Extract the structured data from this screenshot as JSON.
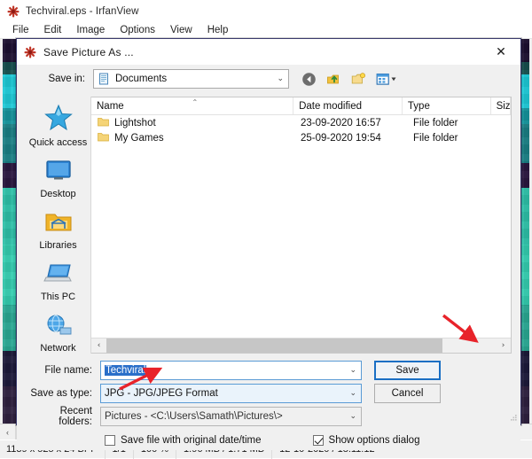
{
  "app": {
    "title": "Techviral.eps - IrfanView",
    "icon": "irfanview-icon",
    "menu": [
      "File",
      "Edit",
      "Image",
      "Options",
      "View",
      "Help"
    ]
  },
  "statusbar": {
    "dimensions": "1139 x 525 x 24 BPP",
    "page": "1/1",
    "zoom": "100 %",
    "size": "1.96 MB / 1.71 MB",
    "datetime": "12-10-2020 / 18:11:12"
  },
  "dialog": {
    "title": "Save Picture As ...",
    "icon": "irfanview-icon",
    "close_label": "✕",
    "savein": {
      "label": "Save in:",
      "value": "Documents",
      "icon": "documents-folder-icon",
      "arrow": "⌄"
    },
    "toolbar": [
      {
        "name": "back-icon",
        "title": "Back"
      },
      {
        "name": "up-one-level-icon",
        "title": "Up one level"
      },
      {
        "name": "new-folder-icon",
        "title": "Create New Folder"
      },
      {
        "name": "views-icon",
        "title": "Views"
      }
    ],
    "places": [
      {
        "label": "Quick access",
        "icon": "quick-access-star-icon"
      },
      {
        "label": "Desktop",
        "icon": "desktop-monitor-icon"
      },
      {
        "label": "Libraries",
        "icon": "libraries-folder-icon"
      },
      {
        "label": "This PC",
        "icon": "this-pc-laptop-icon"
      },
      {
        "label": "Network",
        "icon": "network-globe-icon"
      }
    ],
    "list": {
      "columns": [
        "Name",
        "Date modified",
        "Type",
        "Siz"
      ],
      "sort_indicator": "⌃",
      "rows": [
        {
          "name": "Lightshot",
          "date": "23-09-2020 16:57",
          "type": "File folder",
          "size": ""
        },
        {
          "name": "My Games",
          "date": "25-09-2020 19:54",
          "type": "File folder",
          "size": ""
        }
      ],
      "scroll_left": "‹",
      "scroll_right": "›"
    },
    "form": {
      "filename_label": "File name:",
      "filename_value": "Techviral",
      "savetype_label": "Save as type:",
      "savetype_value": "JPG - JPG/JPEG Format",
      "recent_label": "Recent folders:",
      "recent_value": "Pictures  -  <C:\\Users\\Samath\\Pictures\\>",
      "arrow": "⌄"
    },
    "buttons": {
      "save": "Save",
      "cancel": "Cancel"
    },
    "checkboxes": [
      {
        "label": "Save file with original date/time",
        "checked": false
      },
      {
        "label": "Show options dialog",
        "checked": true
      }
    ]
  },
  "viewer_scroll": {
    "left": "‹",
    "right": "›"
  },
  "annotations": [
    {
      "name": "arrow-to-save-button",
      "color": "#e8232a"
    },
    {
      "name": "arrow-to-save-as-type",
      "color": "#e8232a"
    }
  ],
  "colors": {
    "accent": "#1a6fc4",
    "selection": "#2a6fc9",
    "annotation": "#e8232a",
    "window_bg": "#f0f0f0"
  }
}
